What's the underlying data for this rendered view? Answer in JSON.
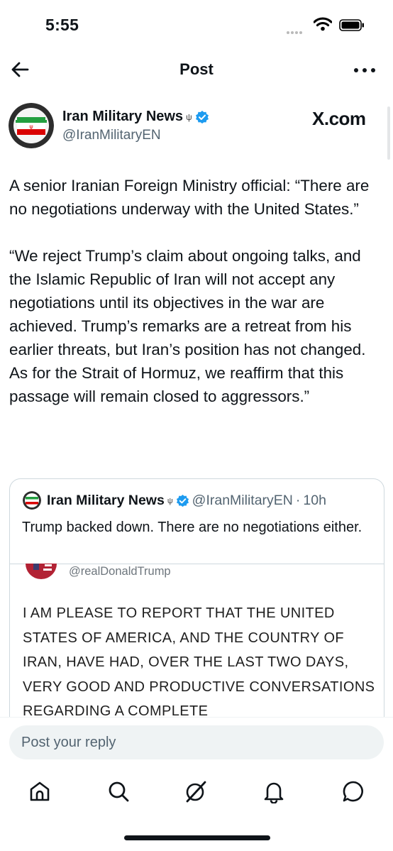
{
  "status_bar": {
    "time": "5:55"
  },
  "header": {
    "title": "Post"
  },
  "author": {
    "name": "Iran Military News",
    "handle": "@IranMilitaryEN",
    "source_label": "X.com"
  },
  "post": {
    "text": "A senior Iranian Foreign Ministry official: “There are no negotiations underway with the United States.”\n\n“We reject Trump’s claim about ongoing talks, and the Islamic Republic of Iran will not accept any negotiations until its objectives in the war are achieved. Trump’s remarks are a retreat from his earlier threats, but Iran’s position has not changed. As for the Strait of Hormuz, we reaffirm that this passage will remain closed to aggressors.”"
  },
  "quoted_post": {
    "name": "Iran Military News",
    "handle": "@IranMilitaryEN",
    "separator": "·",
    "time": "10h",
    "text": "Trump backed down. There are no negotiations either.",
    "image_handle": "@realDonaldTrump",
    "image_text": "I AM PLEASE TO REPORT THAT THE UNITED STATES OF AMERICA, AND THE COUNTRY OF IRAN, HAVE HAD, OVER THE LAST TWO DAYS, VERY GOOD AND PRODUCTIVE CONVERSATIONS REGARDING A COMPLETE"
  },
  "reply": {
    "placeholder": "Post your reply"
  },
  "colors": {
    "accent": "#1d9bf0",
    "text": "#0f1419",
    "secondary": "#536471",
    "border": "#cfd9de"
  },
  "nav": [
    "home-icon",
    "search-icon",
    "grok-icon",
    "notifications-icon",
    "messages-icon"
  ]
}
